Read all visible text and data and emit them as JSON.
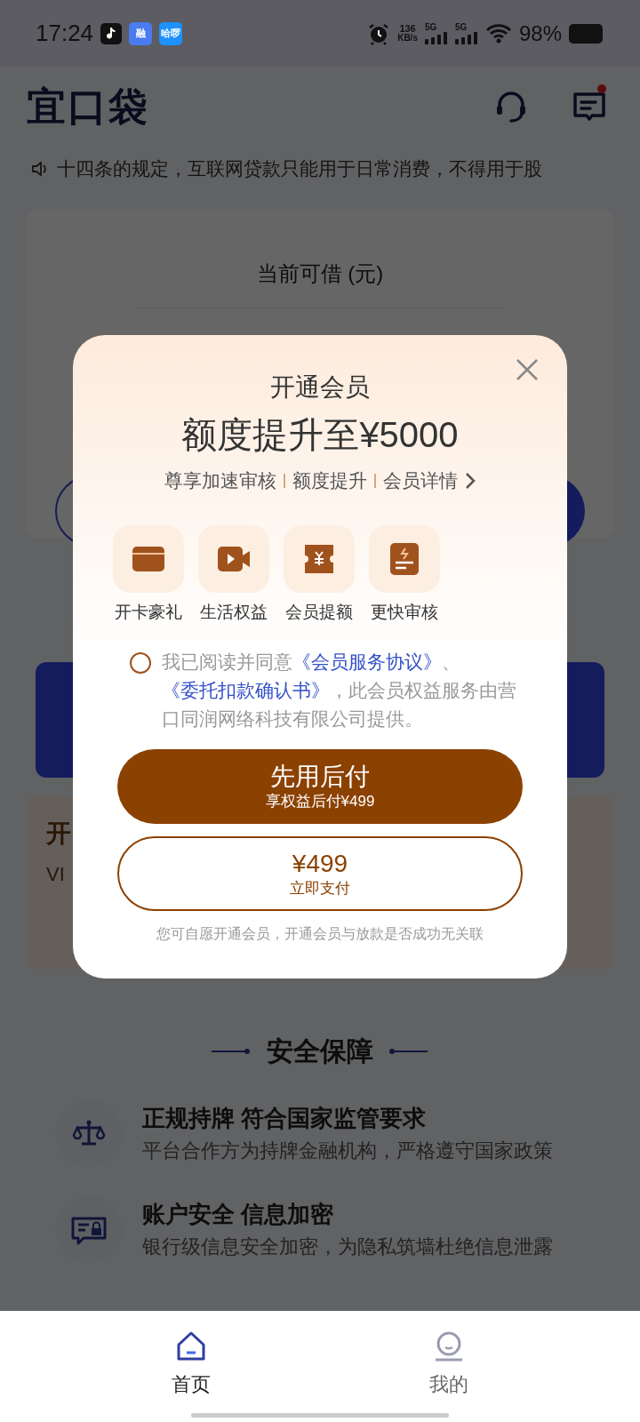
{
  "status_bar": {
    "time": "17:24",
    "apps": [
      {
        "kind": "music"
      },
      {
        "kind": "text",
        "label": "融",
        "color": "#4a7cf0"
      },
      {
        "kind": "text",
        "label": "哈啰",
        "color": "#1e90ff"
      }
    ],
    "speed": "136",
    "speed_unit": "KB/s",
    "networks": [
      "5G",
      "5G"
    ],
    "battery": "98%"
  },
  "header": {
    "logo": "宜口袋",
    "unread": true
  },
  "notice": "十四条的规定，互联网贷款只能用于日常消费，不得用于股",
  "credit_card": {
    "label": "当前可借 (元)"
  },
  "promo_card": {
    "title": "开",
    "subtitle": "VI"
  },
  "security": {
    "title": "安全保障",
    "items": [
      {
        "kind": "scale",
        "title": "正规持牌 符合国家监管要求",
        "desc": "平台合作方为持牌金融机构，严格遵守国家政策"
      },
      {
        "kind": "lock",
        "title": "账户安全 信息加密",
        "desc": "银行级信息安全加密，为隐私筑墙杜绝信息泄露"
      }
    ]
  },
  "modal": {
    "title": "开通会员",
    "headline": "额度提升至¥5000",
    "perks": [
      "尊享加速审核",
      "额度提升",
      "会员详情"
    ],
    "benefits": [
      {
        "kind": "card",
        "label": "开卡豪礼"
      },
      {
        "kind": "video",
        "label": "生活权益"
      },
      {
        "kind": "ticket",
        "label": "会员提额"
      },
      {
        "kind": "doc",
        "label": "更快审核"
      }
    ],
    "agreement": {
      "checked": false,
      "parts": [
        {
          "kind": "plain",
          "text": "我已阅读并同意"
        },
        {
          "kind": "link",
          "text": "《会员服务协议》"
        },
        {
          "kind": "plain",
          "text": "、"
        },
        {
          "kind": "link",
          "text": "《委托扣款确认书》"
        },
        {
          "kind": "plain",
          "text": "，此会员权益服务由营口同润网络科技有限公司提供。"
        }
      ]
    },
    "primary_button": {
      "title": "先用后付",
      "subtitle": "享权益后付¥499"
    },
    "secondary_button": {
      "amount": "¥499",
      "label": "立即支付"
    },
    "note": "您可自愿开通会员，开通会员与放款是否成功无关联"
  },
  "tab_bar": [
    {
      "kind": "home",
      "label": "首页",
      "selected": true
    },
    {
      "kind": "me",
      "label": "我的",
      "selected": false
    }
  ]
}
